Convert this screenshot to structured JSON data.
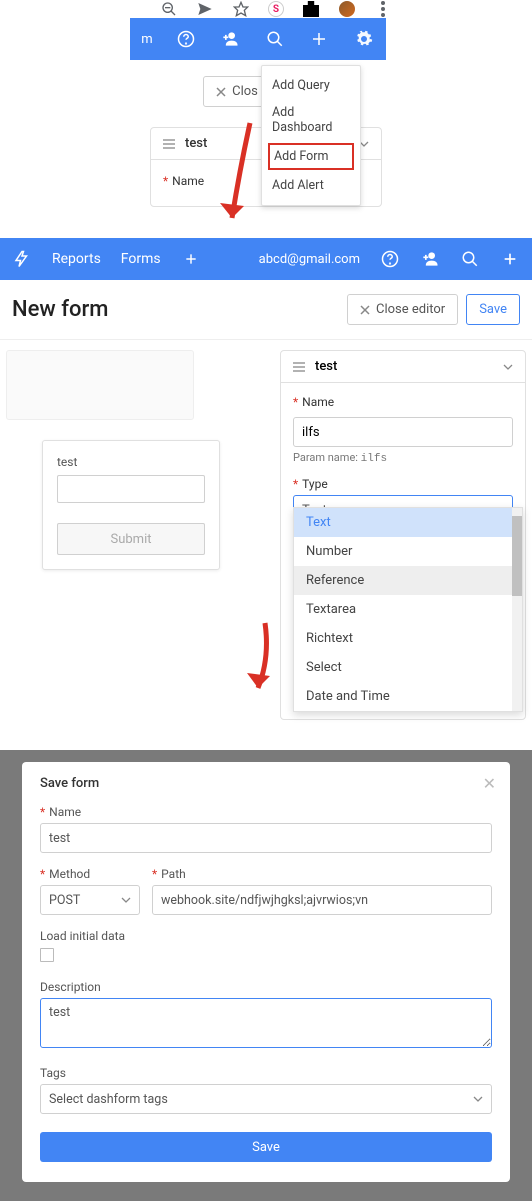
{
  "chrome": {
    "s_label": "S"
  },
  "top": {
    "close_label": "Clos",
    "panel_title": "test",
    "name_label": "Name",
    "menu": [
      "Add Query",
      "Add Dashboard",
      "Add Form",
      "Add Alert"
    ]
  },
  "app": {
    "nav_reports": "Reports",
    "nav_forms": "Forms",
    "user_email": "abcd@gmail.com"
  },
  "editor": {
    "title": "New form",
    "close_label": "Close editor",
    "save_label": "Save",
    "preview_field": "test",
    "submit_label": "Submit",
    "props_title": "test",
    "name_label": "Name",
    "name_value": "ilfs",
    "param_prefix": "Param name: ",
    "param_value": "ilfs",
    "type_label": "Type",
    "type_value": "Text",
    "options": [
      "Text",
      "Number",
      "Reference",
      "Textarea",
      "Richtext",
      "Select",
      "Date and Time"
    ]
  },
  "modal": {
    "title": "Save form",
    "name_label": "Name",
    "name_value": "test",
    "method_label": "Method",
    "method_value": "POST",
    "path_label": "Path",
    "path_value": "webhook.site/ndfjwjhgksl;ajvrwios;vn",
    "load_label": "Load initial data",
    "desc_label": "Description",
    "desc_value": "test",
    "tags_label": "Tags",
    "tags_placeholder": "Select dashform tags",
    "save_label": "Save"
  }
}
